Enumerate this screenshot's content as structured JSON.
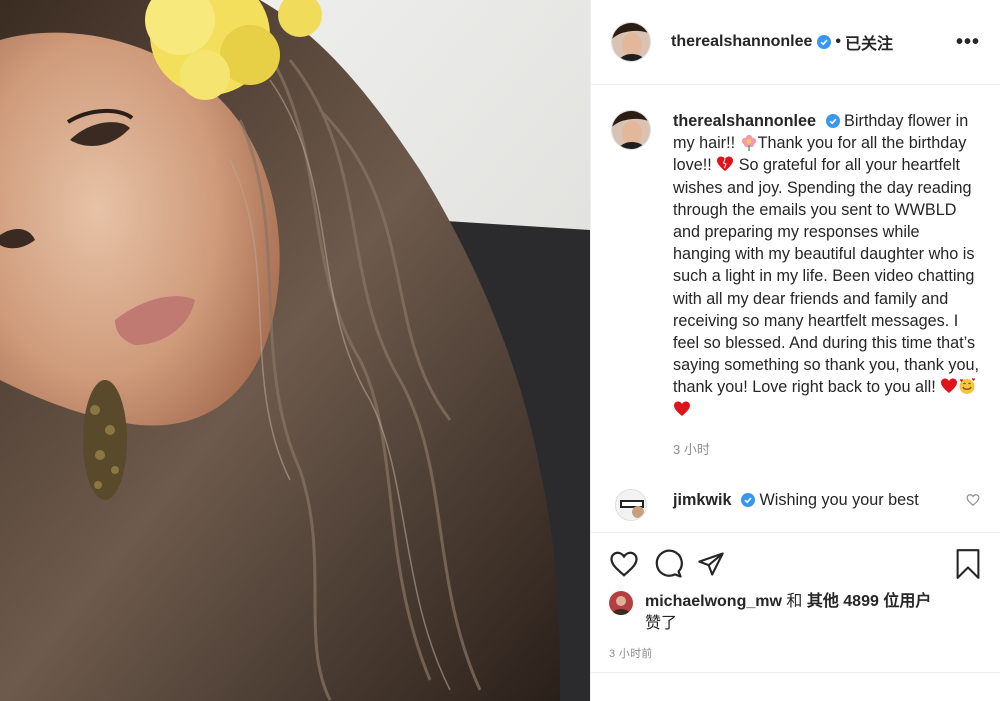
{
  "post": {
    "username": "therealshannonlee",
    "follow_status": "已关注",
    "separator": "•",
    "more_label": "•••",
    "caption_parts": [
      "Birthday flower in my hair!! ",
      "Thank you for all the birthday love!! ",
      " So grateful for all your heartfelt wishes and joy. Spending the day reading through the emails you sent to WWBLD and preparing my responses while hanging with my beautiful daughter who is such a light in my life. Been video chatting with all my dear friends and family and receiving so many heartfelt messages. I feel so blessed. And during this time that’s saying something so thank you, thank you, thank you! Love right back to you all! "
    ],
    "caption_time": "3 小时",
    "comment": {
      "username": "jimkwik",
      "text": "Wishing you your best"
    },
    "likes": {
      "user": "michaelwong_mw",
      "connector": " 和 ",
      "others": "其他 4899 位用户",
      "suffix": "赞了"
    },
    "post_time": "3 小时前"
  },
  "icons": {
    "verified": "verified-badge-icon",
    "like": "heart-outline-icon",
    "comment": "comment-bubble-icon",
    "share": "paper-plane-icon",
    "save": "bookmark-icon"
  },
  "colors": {
    "verified": "#3897f0",
    "emoji_heart": "#e0131a",
    "secondary_text": "#8e8e8e"
  }
}
